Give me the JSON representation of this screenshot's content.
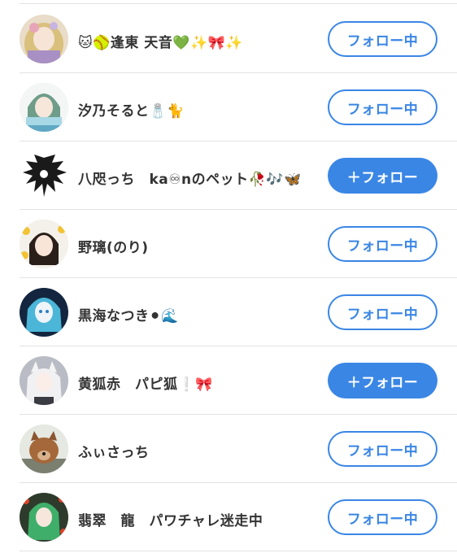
{
  "users": [
    {
      "name": "🐱🥎逢東 天音💚✨🎀✨",
      "button": "フォロー中",
      "state": "following"
    },
    {
      "name": "汐乃そると🧂🐈",
      "button": "フォロー中",
      "state": "following"
    },
    {
      "name": "八咫っち　ka♾nのペット🥀🎶🦋",
      "button": "＋フォロー",
      "state": "follow"
    },
    {
      "name": "野璃(のり)",
      "button": "フォロー中",
      "state": "following"
    },
    {
      "name": "黒海なつき⚫🌊",
      "button": "フォロー中",
      "state": "following"
    },
    {
      "name": "黄狐赤　パピ狐❕🎀",
      "button": "＋フォロー",
      "state": "follow"
    },
    {
      "name": "ふぃさっち",
      "button": "フォロー中",
      "state": "following"
    },
    {
      "name": "翡翠　龍　パワチャレ迷走中",
      "button": "フォロー中",
      "state": "following"
    }
  ],
  "colors": {
    "accent": "#3a86e5",
    "text": "#333333",
    "separator": "#e3e3e6"
  }
}
